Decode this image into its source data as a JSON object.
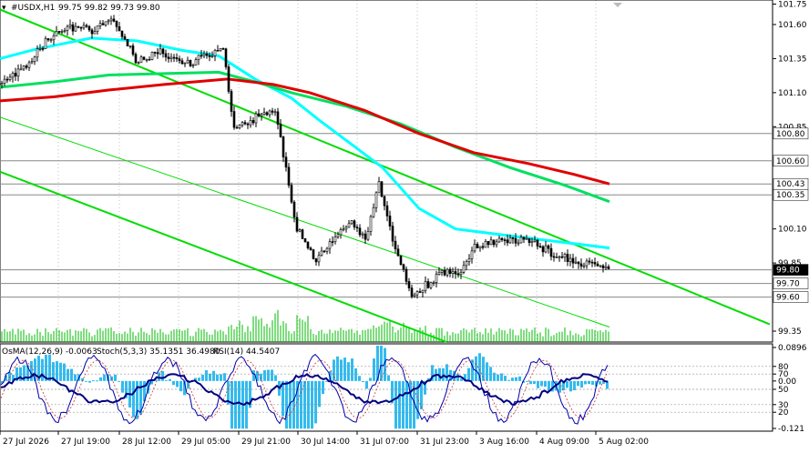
{
  "header": {
    "symbol": "#USDX,H1",
    "ohlc": "99.75 99.82 99.73 99.80"
  },
  "sub_header": {
    "osma": "OsMA(12,26,9) -0.0063",
    "stoch": "Stoch(5,3,3) 35.1351 36.4980",
    "rsi": "RSI(14) 44.5407"
  },
  "price_axis": {
    "ticks": [
      "101.75",
      "101.60",
      "101.35",
      "101.10",
      "100.85",
      "100.10",
      "99.85",
      "99.35"
    ],
    "level_tags": [
      "100.80",
      "100.60",
      "100.43",
      "100.35",
      "99.80",
      "99.70",
      "99.60"
    ],
    "current_price": "99.80"
  },
  "sub_axis": {
    "ticks": [
      "0.0896",
      "80",
      "70",
      "0.00",
      "50",
      "30",
      "20",
      "-0.121"
    ]
  },
  "time_axis": {
    "labels": [
      "27 Jul 2026",
      "27 Jul 19:00",
      "28 Jul 12:00",
      "29 Jul 05:00",
      "29 Jul 21:00",
      "30 Jul 14:00",
      "31 Jul 07:00",
      "31 Jul 23:00",
      "3 Aug 16:00",
      "4 Aug 09:00",
      "5 Aug 02:00"
    ]
  },
  "colors": {
    "ema_fast": "#00ffff",
    "ema_mid": "#00e060",
    "ema_slow": "#e00000",
    "channel": "#00dd00",
    "osma_hist": "#33bbee",
    "stoch_main": "#0000aa",
    "rsi_line": "#000080"
  },
  "chart_data": [
    {
      "type": "candlestick",
      "title": "#USDX,H1",
      "ylim": [
        99.27,
        101.78
      ],
      "y_ticks": [
        101.75,
        101.6,
        101.35,
        101.1,
        100.85,
        100.1,
        99.85,
        99.35
      ],
      "level_lines": [
        100.8,
        100.6,
        100.43,
        100.35,
        99.8,
        99.7,
        99.6
      ],
      "close_path": [
        [
          0,
          101.16
        ],
        [
          25,
          101.28
        ],
        [
          50,
          101.48
        ],
        [
          75,
          101.58
        ],
        [
          100,
          101.56
        ],
        [
          125,
          101.62
        ],
        [
          150,
          101.32
        ],
        [
          175,
          101.4
        ],
        [
          200,
          101.3
        ],
        [
          225,
          101.37
        ],
        [
          245,
          101.42
        ],
        [
          255,
          100.85
        ],
        [
          275,
          100.9
        ],
        [
          300,
          100.98
        ],
        [
          310,
          100.65
        ],
        [
          325,
          100.1
        ],
        [
          345,
          99.87
        ],
        [
          365,
          100.02
        ],
        [
          385,
          100.14
        ],
        [
          400,
          100.03
        ],
        [
          415,
          100.42
        ],
        [
          430,
          100.02
        ],
        [
          450,
          99.62
        ],
        [
          470,
          99.7
        ],
        [
          490,
          99.8
        ],
        [
          505,
          99.77
        ],
        [
          520,
          99.96
        ],
        [
          540,
          100.0
        ],
        [
          570,
          100.02
        ],
        [
          590,
          99.98
        ],
        [
          610,
          99.9
        ],
        [
          640,
          99.85
        ],
        [
          669,
          99.8
        ]
      ],
      "series": [
        {
          "name": "",
          "role": "ema_fast",
          "points": [
            [
              0,
              101.35
            ],
            [
              40,
              101.42
            ],
            [
              100,
              101.5
            ],
            [
              150,
              101.48
            ],
            [
              200,
              101.41
            ],
            [
              240,
              101.37
            ],
            [
              280,
              101.2
            ],
            [
              320,
              101.06
            ],
            [
              350,
              100.9
            ],
            [
              380,
              100.75
            ],
            [
              420,
              100.55
            ],
            [
              460,
              100.25
            ],
            [
              500,
              100.1
            ],
            [
              560,
              100.05
            ],
            [
              620,
              100.0
            ],
            [
              669,
              99.96
            ]
          ]
        },
        {
          "name": "",
          "role": "ema_mid",
          "points": [
            [
              0,
              101.14
            ],
            [
              60,
              101.18
            ],
            [
              120,
              101.23
            ],
            [
              180,
              101.24
            ],
            [
              240,
              101.25
            ],
            [
              280,
              101.18
            ],
            [
              320,
              101.1
            ],
            [
              380,
              101.0
            ],
            [
              440,
              100.87
            ],
            [
              500,
              100.7
            ],
            [
              560,
              100.55
            ],
            [
              620,
              100.42
            ],
            [
              669,
              100.3
            ]
          ]
        },
        {
          "name": "",
          "role": "ema_slow",
          "points": [
            [
              0,
              101.04
            ],
            [
              60,
              101.07
            ],
            [
              120,
              101.12
            ],
            [
              180,
              101.16
            ],
            [
              250,
              101.2
            ],
            [
              300,
              101.16
            ],
            [
              340,
              101.1
            ],
            [
              400,
              100.97
            ],
            [
              460,
              100.8
            ],
            [
              520,
              100.66
            ],
            [
              580,
              100.58
            ],
            [
              630,
              100.5
            ],
            [
              669,
              100.43
            ]
          ]
        }
      ],
      "channel_lines": [
        {
          "role": "upper",
          "from": [
            0,
            101.71
          ],
          "to": [
            845,
            99.4
          ]
        },
        {
          "role": "middle",
          "from": [
            0,
            100.92
          ],
          "to": [
            669,
            99.38
          ]
        },
        {
          "role": "lower",
          "from": [
            0,
            100.52
          ],
          "to": [
            490,
            99.27
          ]
        }
      ]
    },
    {
      "type": "indicator",
      "title": "OsMA(12,26,9) / Stoch(5,3,3) / RSI(14)",
      "ylim": [
        -0.121,
        0.0896
      ],
      "levels": [
        80,
        70,
        50,
        30,
        20
      ],
      "osma_value": -0.0063,
      "stoch_main": 35.1351,
      "stoch_signal": 36.498,
      "rsi": 44.5407
    }
  ]
}
